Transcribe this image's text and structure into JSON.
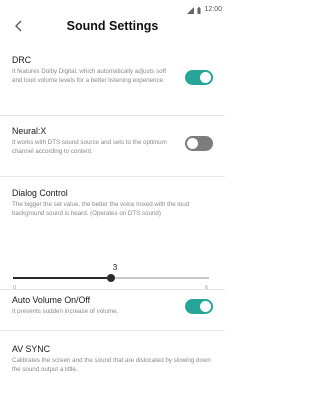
{
  "status_bar": {
    "time": "12:00"
  },
  "header": {
    "title": "Sound Settings"
  },
  "settings": {
    "drc": {
      "title": "DRC",
      "description": "It features Dolby Digital, which automatically adjusts soft and loud volume levels for a better listening experience.",
      "enabled": true
    },
    "neural_x": {
      "title": "Neural:X",
      "description": "It works with DTS sound source and sets to the optimum channel according to content.",
      "enabled": false
    },
    "dialog_control": {
      "title": "Dialog Control",
      "description": "The bigger the set value, the better the voice mixed with the loud background sound is heard. (Operates on DTS sound)",
      "value": "3",
      "min": "0",
      "max": "6"
    },
    "auto_volume": {
      "title": "Auto Volume On/Off",
      "description": "It prevents sudden increase of volume.",
      "enabled": true
    },
    "av_sync": {
      "title": "AV SYNC",
      "description": "Calibrates the screen and the sound that are dislocated by slowing down the sound output a little."
    }
  },
  "colors": {
    "accent": "#26a69a",
    "toggle_off": "#7c7c7c",
    "slider": "#2b2b2b"
  }
}
